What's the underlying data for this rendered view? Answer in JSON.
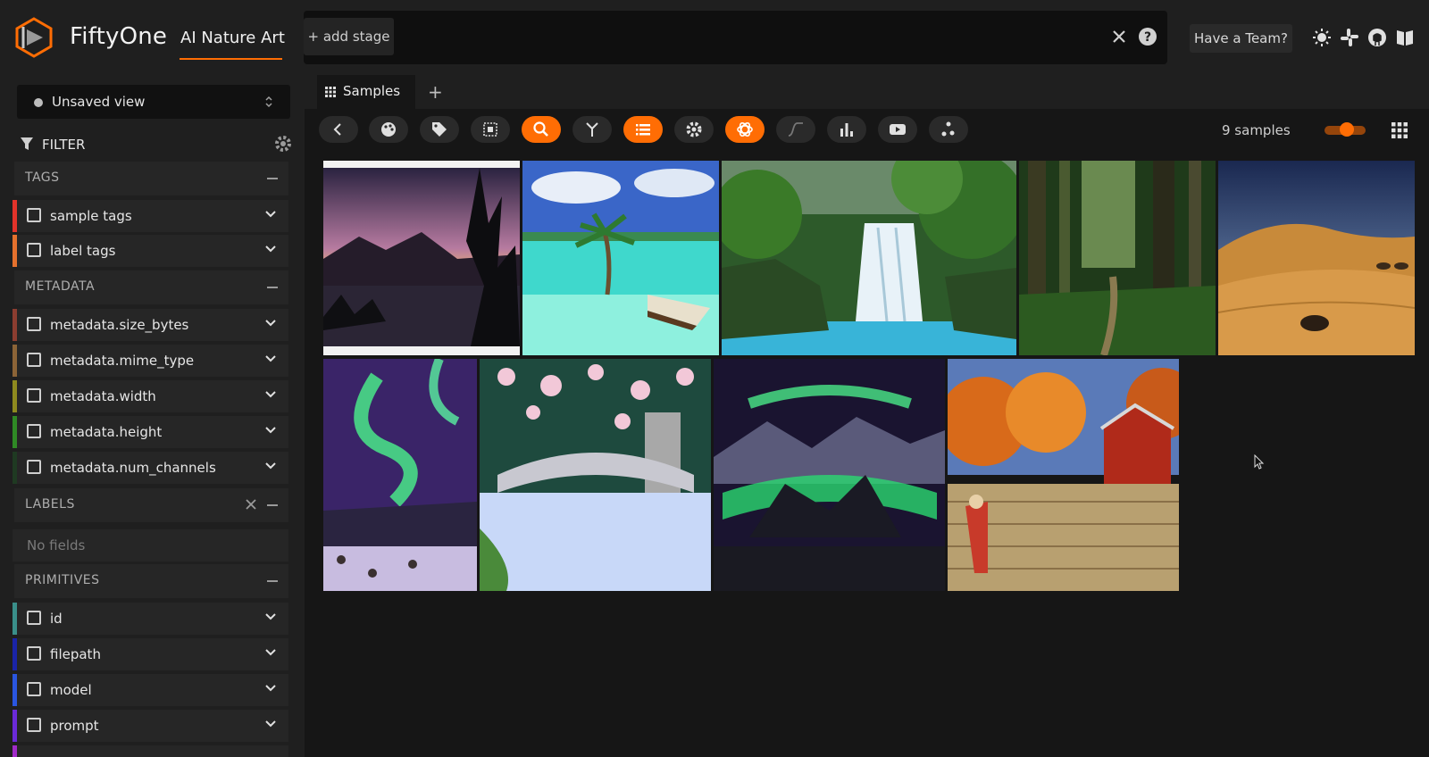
{
  "header": {
    "brand": "FiftyOne",
    "dataset": "AI Nature Art",
    "add_stage": "+ add stage",
    "team_button": "Have a Team?",
    "accent_color": "#ff6d04",
    "icons": [
      "close-icon",
      "help-icon",
      "theme-light-icon",
      "slack-icon",
      "github-icon",
      "docs-book-icon"
    ]
  },
  "sidebar": {
    "view_selector": "Unsaved view",
    "filter_title": "FILTER",
    "groups": {
      "tags": {
        "title": "TAGS",
        "fields": [
          {
            "label": "sample tags",
            "color": "#e2332a"
          },
          {
            "label": "label tags",
            "color": "#e5712d"
          }
        ]
      },
      "metadata": {
        "title": "METADATA",
        "fields": [
          {
            "label": "metadata.size_bytes",
            "color": "#8c3d30"
          },
          {
            "label": "metadata.mime_type",
            "color": "#8c6437"
          },
          {
            "label": "metadata.width",
            "color": "#8e8a1f"
          },
          {
            "label": "metadata.height",
            "color": "#2f8a25"
          },
          {
            "label": "metadata.num_channels",
            "color": "#1f3a22"
          }
        ]
      },
      "labels": {
        "title": "LABELS",
        "empty_text": "No fields"
      },
      "primitives": {
        "title": "PRIMITIVES",
        "fields": [
          {
            "label": "id",
            "color": "#3a8f8a"
          },
          {
            "label": "filepath",
            "color": "#1a24a8"
          },
          {
            "label": "model",
            "color": "#2a56e0"
          },
          {
            "label": "prompt",
            "color": "#6a2ad8"
          }
        ]
      }
    }
  },
  "main": {
    "tabs": [
      {
        "label": "Samples"
      }
    ],
    "toolbar": {
      "buttons": [
        {
          "name": "back-icon",
          "active": false
        },
        {
          "name": "color-palette-icon",
          "active": false
        },
        {
          "name": "tag-icon",
          "active": false
        },
        {
          "name": "patches-icon",
          "active": false
        },
        {
          "name": "similarity-search-icon",
          "active": true
        },
        {
          "name": "merge-icon",
          "active": false
        },
        {
          "name": "list-icon",
          "active": true
        },
        {
          "name": "settings-icon",
          "active": false
        },
        {
          "name": "openai-icon",
          "active": true
        },
        {
          "name": "curve-icon",
          "active": false
        },
        {
          "name": "bar-chart-icon",
          "active": false
        },
        {
          "name": "youtube-icon",
          "active": false
        },
        {
          "name": "embeddings-icon",
          "active": false
        }
      ]
    },
    "sample_count": "9 samples",
    "grid_zoom": 0.6,
    "samples": [
      {
        "subject": "sunset lake with pine silhouette"
      },
      {
        "subject": "tropical palm islet with boat"
      },
      {
        "subject": "jungle waterfall"
      },
      {
        "subject": "mossy forest path"
      },
      {
        "subject": "desert dunes at night"
      },
      {
        "subject": "aurora over wolves"
      },
      {
        "subject": "cherry blossom bridge"
      },
      {
        "subject": "aurora over mountains"
      },
      {
        "subject": "autumn barn with scarecrow"
      }
    ]
  }
}
